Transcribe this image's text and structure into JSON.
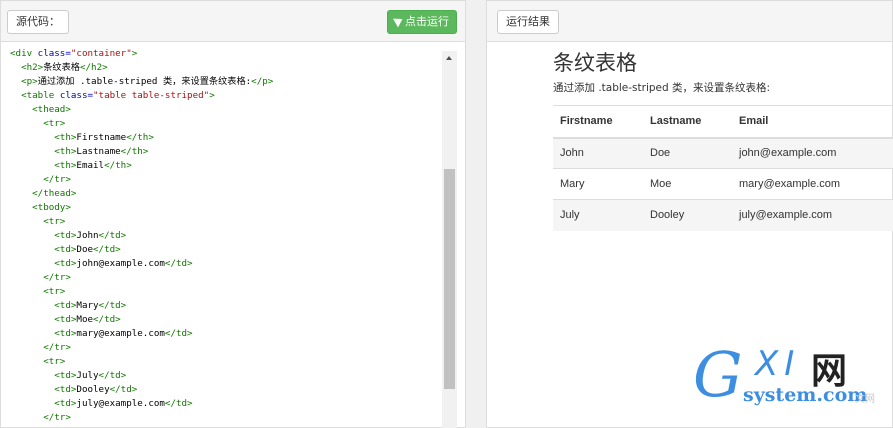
{
  "left_panel": {
    "source_button": "源代码：",
    "run_button": "点击运行",
    "code_lines": [
      [
        [
          "tg",
          "<div "
        ],
        [
          "at",
          "class="
        ],
        [
          "st",
          "\"container\""
        ],
        [
          "tg",
          ">"
        ]
      ],
      [
        [
          "tx",
          "  "
        ],
        [
          "tg",
          "<h2>"
        ],
        [
          "tx",
          "条纹表格"
        ],
        [
          "tg",
          "</h2>"
        ]
      ],
      [
        [
          "tx",
          "  "
        ],
        [
          "tg",
          "<p>"
        ],
        [
          "tx",
          "通过添加 .table-striped 类，来设置条纹表格:"
        ],
        [
          "tg",
          "</p>"
        ]
      ],
      [
        [
          "tx",
          "  "
        ],
        [
          "tg",
          "<table "
        ],
        [
          "at",
          "class="
        ],
        [
          "st",
          "\"table table-striped\""
        ],
        [
          "tg",
          ">"
        ]
      ],
      [
        [
          "tx",
          "    "
        ],
        [
          "tg",
          "<thead>"
        ]
      ],
      [
        [
          "tx",
          "      "
        ],
        [
          "tg",
          "<tr>"
        ]
      ],
      [
        [
          "tx",
          "        "
        ],
        [
          "tg",
          "<th>"
        ],
        [
          "tx",
          "Firstname"
        ],
        [
          "tg",
          "</th>"
        ]
      ],
      [
        [
          "tx",
          "        "
        ],
        [
          "tg",
          "<th>"
        ],
        [
          "tx",
          "Lastname"
        ],
        [
          "tg",
          "</th>"
        ]
      ],
      [
        [
          "tx",
          "        "
        ],
        [
          "tg",
          "<th>"
        ],
        [
          "tx",
          "Email"
        ],
        [
          "tg",
          "</th>"
        ]
      ],
      [
        [
          "tx",
          "      "
        ],
        [
          "tg",
          "</tr>"
        ]
      ],
      [
        [
          "tx",
          "    "
        ],
        [
          "tg",
          "</thead>"
        ]
      ],
      [
        [
          "tx",
          "    "
        ],
        [
          "tg",
          "<tbody>"
        ]
      ],
      [
        [
          "tx",
          "      "
        ],
        [
          "tg",
          "<tr>"
        ]
      ],
      [
        [
          "tx",
          "        "
        ],
        [
          "tg",
          "<td>"
        ],
        [
          "tx",
          "John"
        ],
        [
          "tg",
          "</td>"
        ]
      ],
      [
        [
          "tx",
          "        "
        ],
        [
          "tg",
          "<td>"
        ],
        [
          "tx",
          "Doe"
        ],
        [
          "tg",
          "</td>"
        ]
      ],
      [
        [
          "tx",
          "        "
        ],
        [
          "tg",
          "<td>"
        ],
        [
          "tx",
          "john@example.com"
        ],
        [
          "tg",
          "</td>"
        ]
      ],
      [
        [
          "tx",
          "      "
        ],
        [
          "tg",
          "</tr>"
        ]
      ],
      [
        [
          "tx",
          "      "
        ],
        [
          "tg",
          "<tr>"
        ]
      ],
      [
        [
          "tx",
          "        "
        ],
        [
          "tg",
          "<td>"
        ],
        [
          "tx",
          "Mary"
        ],
        [
          "tg",
          "</td>"
        ]
      ],
      [
        [
          "tx",
          "        "
        ],
        [
          "tg",
          "<td>"
        ],
        [
          "tx",
          "Moe"
        ],
        [
          "tg",
          "</td>"
        ]
      ],
      [
        [
          "tx",
          "        "
        ],
        [
          "tg",
          "<td>"
        ],
        [
          "tx",
          "mary@example.com"
        ],
        [
          "tg",
          "</td>"
        ]
      ],
      [
        [
          "tx",
          "      "
        ],
        [
          "tg",
          "</tr>"
        ]
      ],
      [
        [
          "tx",
          "      "
        ],
        [
          "tg",
          "<tr>"
        ]
      ],
      [
        [
          "tx",
          "        "
        ],
        [
          "tg",
          "<td>"
        ],
        [
          "tx",
          "July"
        ],
        [
          "tg",
          "</td>"
        ]
      ],
      [
        [
          "tx",
          "        "
        ],
        [
          "tg",
          "<td>"
        ],
        [
          "tx",
          "Dooley"
        ],
        [
          "tg",
          "</td>"
        ]
      ],
      [
        [
          "tx",
          "        "
        ],
        [
          "tg",
          "<td>"
        ],
        [
          "tx",
          "july@example.com"
        ],
        [
          "tg",
          "</td>"
        ]
      ],
      [
        [
          "tx",
          "      "
        ],
        [
          "tg",
          "</tr>"
        ]
      ]
    ]
  },
  "right_panel": {
    "result_button": "运行结果",
    "title": "条纹表格",
    "description": "通过添加 .table-striped 类，来设置条纹表格:",
    "table": {
      "headers": [
        "Firstname",
        "Lastname",
        "Email"
      ],
      "rows": [
        [
          "John",
          "Doe",
          "john@example.com"
        ],
        [
          "Mary",
          "Moe",
          "mary@example.com"
        ],
        [
          "July",
          "Dooley",
          "july@example.com"
        ]
      ]
    }
  },
  "watermark": {
    "g": "G",
    "xi": "XI",
    "wang": "网",
    "domain": "system.com",
    "faint": "文网"
  },
  "colors": {
    "run_button": "#5cb85c",
    "code_tag": "#117700",
    "code_attr": "#0000cc",
    "code_string": "#aa1111",
    "watermark_blue": "#3d8ee0"
  }
}
